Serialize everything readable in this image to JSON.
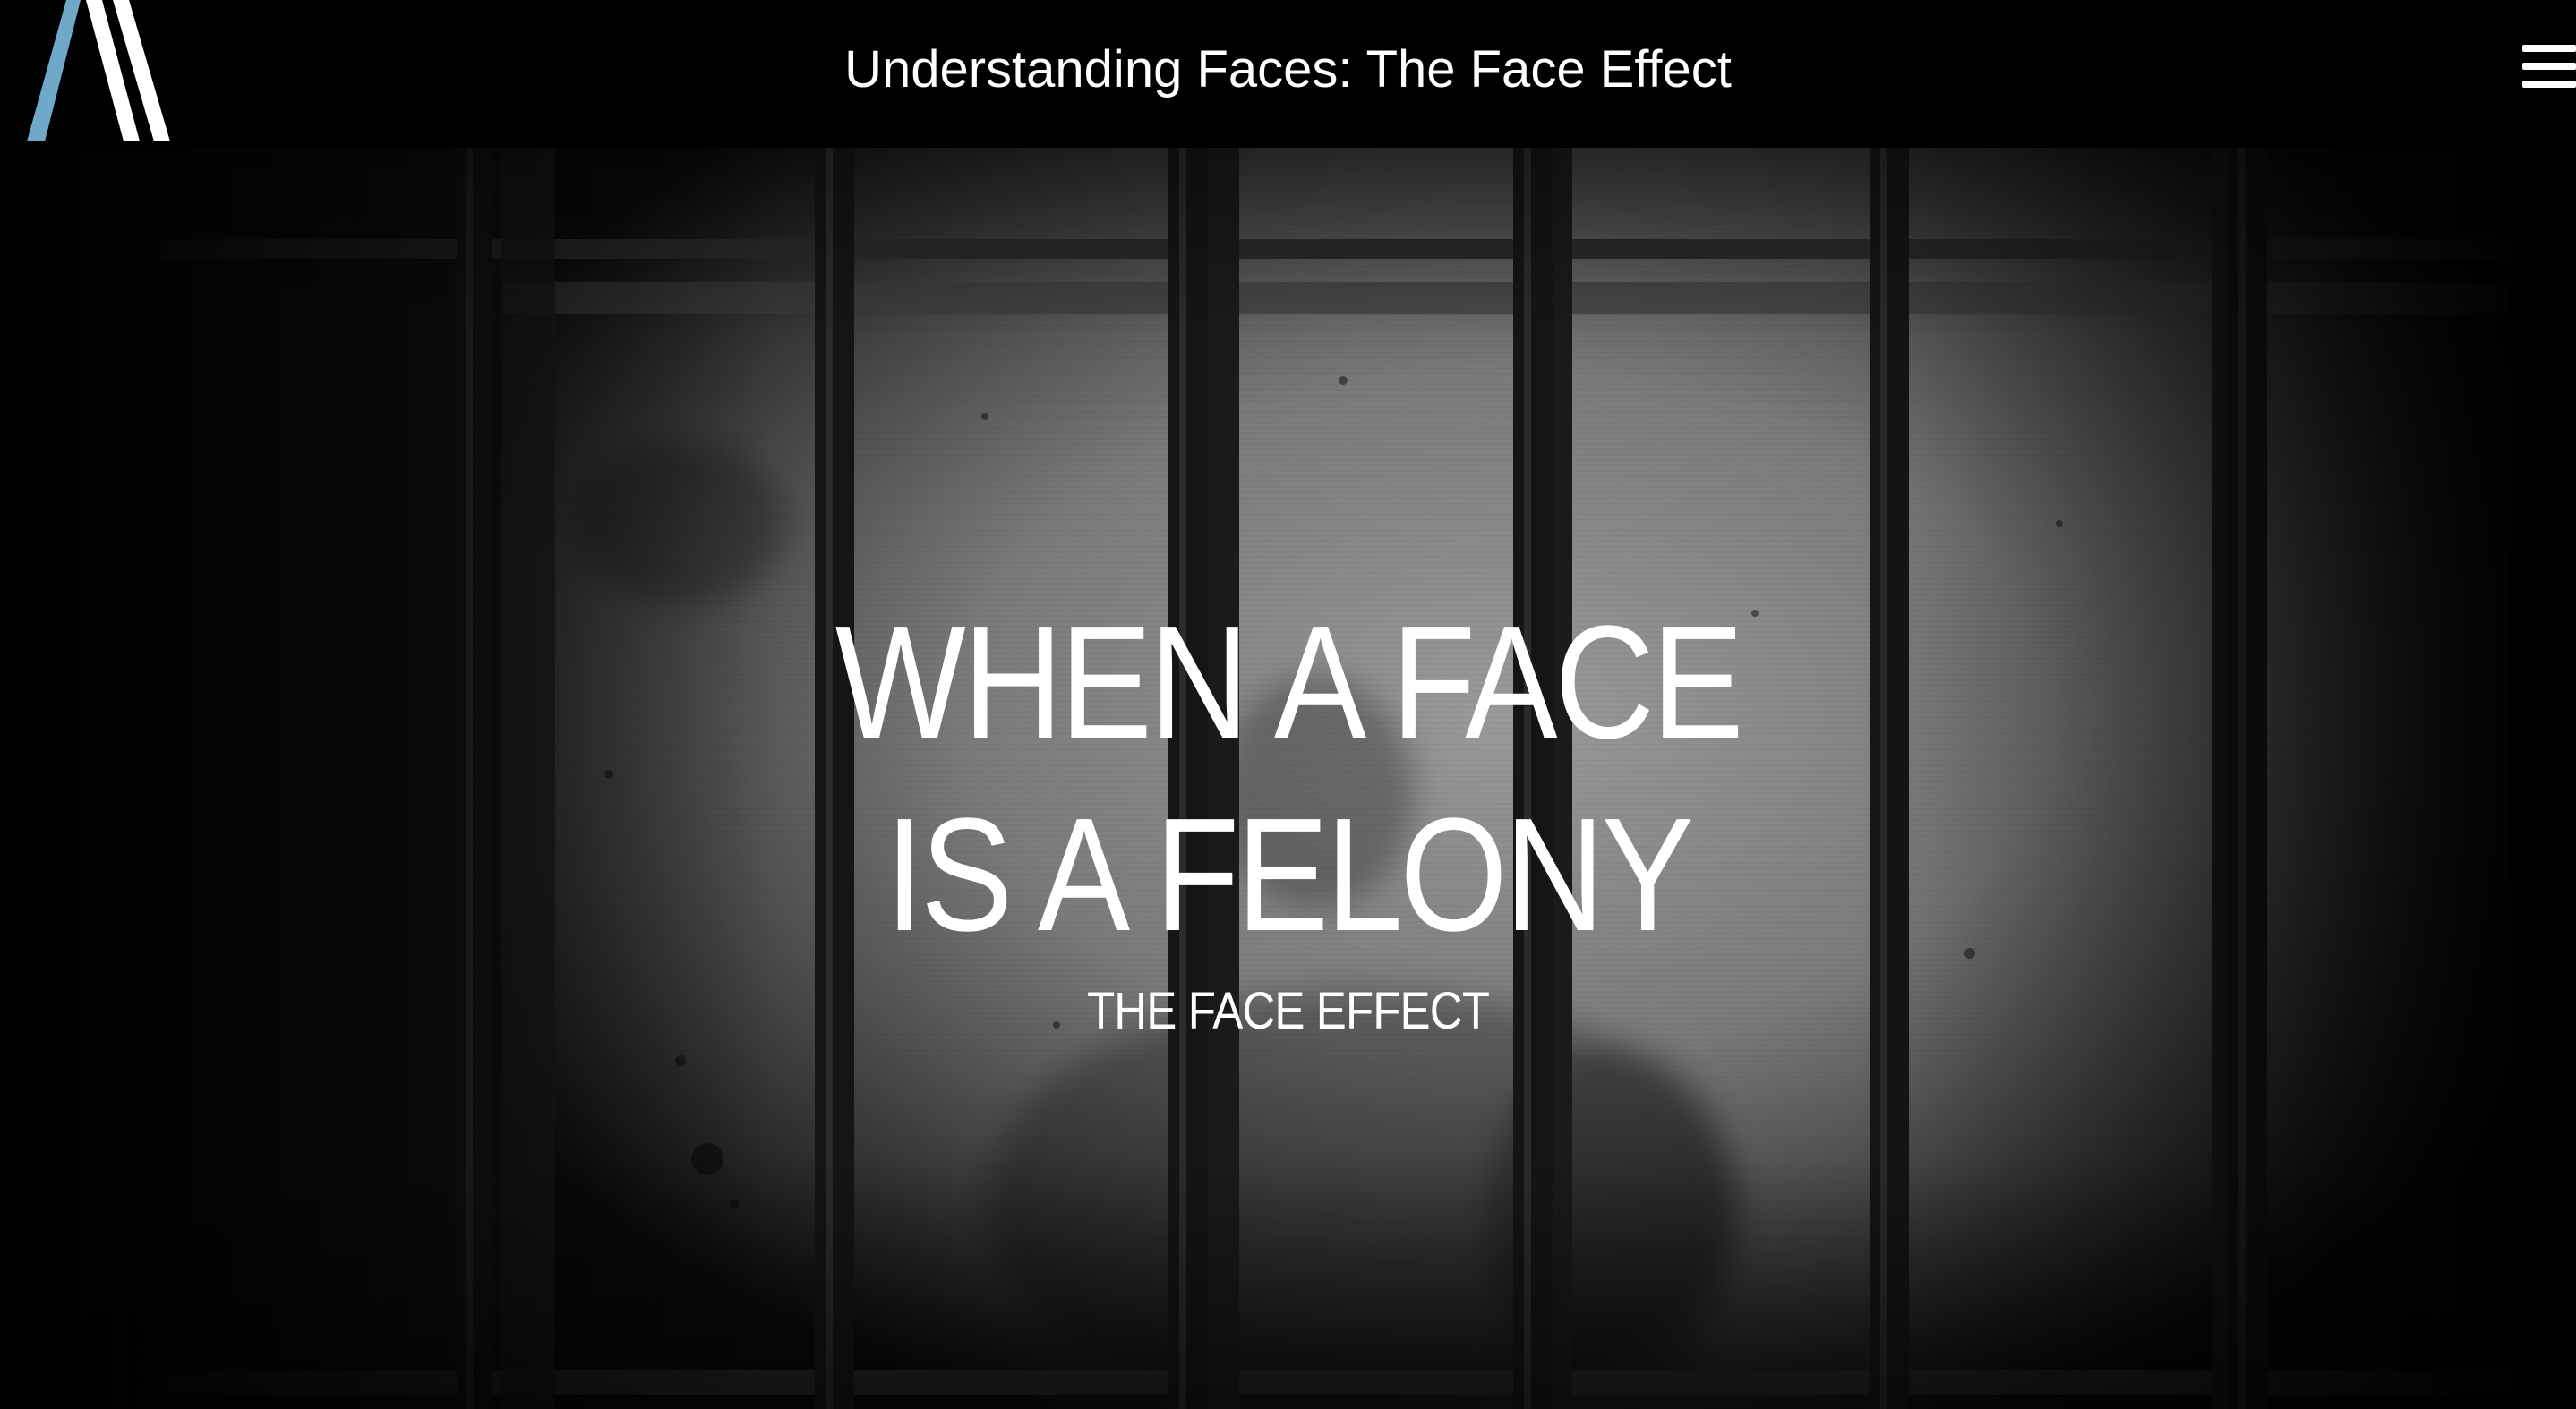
{
  "header": {
    "title": "Understanding Faces: The Face Effect",
    "logo_icon": "stylized-A-logo-icon",
    "menu_icon": "hamburger-menu-icon"
  },
  "hero": {
    "headline_line1": "WHEN A FACE",
    "headline_line2": "IS A FELONY",
    "subheading": "THE FACE EFFECT",
    "background_description_icon": "prison-window-bars-image"
  },
  "colors": {
    "topbar_bg": "#000000",
    "logo_accent": "#6fa8c8",
    "text": "#ffffff"
  }
}
